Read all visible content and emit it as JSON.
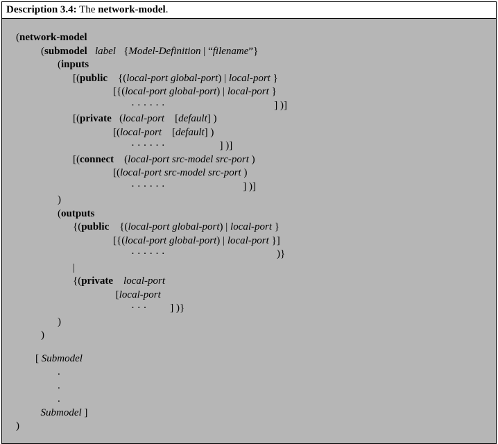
{
  "header": {
    "desc_label": "Description 3.4:",
    "desc_text": " The ",
    "desc_bold": "network-model",
    "desc_end": "."
  },
  "kw": {
    "network_model": "network-model",
    "submodel": "submodel",
    "inputs": "inputs",
    "outputs": "outputs",
    "public": "public",
    "private": "private",
    "connect": "connect"
  },
  "it": {
    "label": "label",
    "model_def": "Model-Definition",
    "filename": "filename",
    "local_port": "local-port",
    "global_port": "global-port",
    "default": "default",
    "src_model": "src-model",
    "src_port": "src-port",
    "submodel_cap": "Submodel"
  },
  "sym": {
    "dots6": "· · · · · ·",
    "dots3": "· · ·",
    "vdots": ".",
    "pipe": "|",
    "quote_l": "“",
    "quote_r": "”"
  }
}
